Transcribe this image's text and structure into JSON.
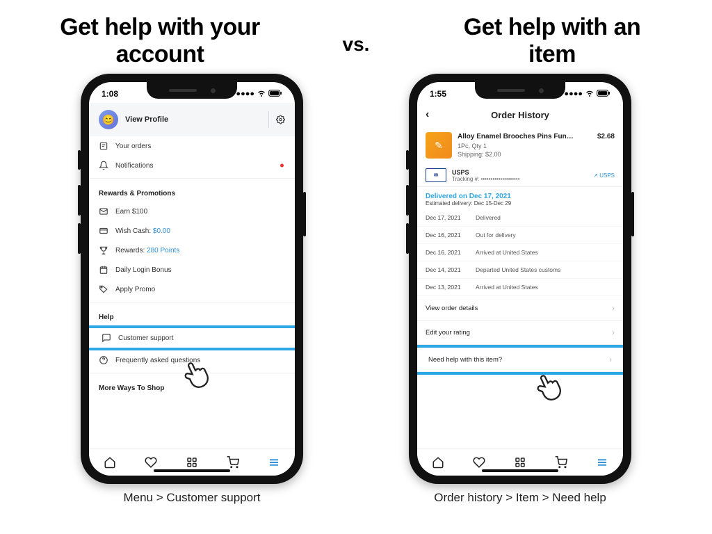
{
  "headings": {
    "left": "Get help with your account",
    "right": "Get help with an item",
    "vs": "vs."
  },
  "captions": {
    "left": "Menu > Customer support",
    "right": "Order history > Item > Need help"
  },
  "left_phone": {
    "time": "1:08",
    "profile_label": "View Profile",
    "menu": {
      "your_orders": "Your orders",
      "notifications": "Notifications",
      "section_rewards": "Rewards & Promotions",
      "earn": "Earn $100",
      "wish_cash_label": "Wish Cash:",
      "wish_cash_value": "$0.00",
      "rewards_label": "Rewards:",
      "rewards_value": "280 Points",
      "daily_login": "Daily Login Bonus",
      "apply_promo": "Apply Promo",
      "section_help": "Help",
      "customer_support": "Customer support",
      "faq": "Frequently asked questions",
      "section_more": "More Ways To Shop"
    }
  },
  "right_phone": {
    "time": "1:55",
    "title": "Order History",
    "order": {
      "title": "Alloy Enamel Brooches Pins Fun…",
      "price": "$2.68",
      "qty": "1Pc, Qty 1",
      "ship": "Shipping: $2.00"
    },
    "shipping": {
      "carrier": "USPS",
      "tracking_label": "Tracking #:",
      "tracking_value": "••••••••••••••••••••",
      "link": "USPS"
    },
    "delivery": {
      "delivered": "Delivered on Dec 17, 2021",
      "estimated": "Estimated delivery: Dec 15-Dec 29"
    },
    "tracking": [
      {
        "date": "Dec 17, 2021",
        "event": "Delivered"
      },
      {
        "date": "Dec 16, 2021",
        "event": "Out for delivery"
      },
      {
        "date": "Dec 16, 2021",
        "event": "Arrived at United States"
      },
      {
        "date": "Dec 14, 2021",
        "event": "Departed United States customs"
      },
      {
        "date": "Dec 13, 2021",
        "event": "Arrived at United States"
      }
    ],
    "actions": {
      "view_details": "View order details",
      "edit_rating": "Edit your rating",
      "need_help": "Need help with this item?"
    }
  }
}
